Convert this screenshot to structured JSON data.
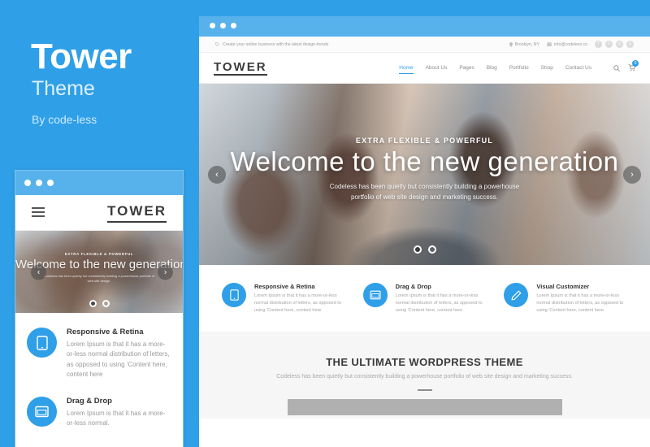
{
  "promo": {
    "title": "Tower",
    "subtitle": "Theme",
    "author": "By code-less"
  },
  "colors": {
    "brand_blue": "#2fa0e8",
    "chrome_blue": "#57b2ec",
    "icon_blue": "#2f9fe8",
    "cta_bg": "#f6f6f6"
  },
  "desktop_window": {
    "topbar": {
      "tagline": "Create your online business with the latest design-trends",
      "location": "Brooklyn, NY",
      "email": "info@codeless.co",
      "social": [
        "facebook-icon",
        "twitter-icon",
        "google-plus-icon",
        "pinterest-icon"
      ]
    },
    "nav": {
      "logo": "TOWER",
      "items": [
        {
          "label": "Home",
          "active": true
        },
        {
          "label": "About Us",
          "active": false
        },
        {
          "label": "Pages",
          "active": false
        },
        {
          "label": "Blog",
          "active": false
        },
        {
          "label": "Portfolio",
          "active": false
        },
        {
          "label": "Shop",
          "active": false
        },
        {
          "label": "Contact Us",
          "active": false
        }
      ],
      "search_icon": "search-icon",
      "cart_icon": "cart-icon",
      "cart_count": "0"
    },
    "hero": {
      "kicker": "EXTRA FLEXIBLE & POWERFUL",
      "title": "Welcome to the new generation",
      "description": "Codeless has been quietly but consistently building a powerhouse portfolio of web site design and marketing success.",
      "prev_label": "‹",
      "next_label": "›",
      "slides": 2,
      "active_slide": 1
    },
    "features": [
      {
        "icon": "tablet-icon",
        "title": "Responsive & Retina",
        "text": "Lorem Ipsum is that it has a more-or-less normal distribution of letters, as opposed to using 'Content here, content here"
      },
      {
        "icon": "drag-drop-icon",
        "title": "Drag & Drop",
        "text": "Lorem Ipsum is that it has a more-or-less normal distribution of letters, as opposed to using 'Content here, content here"
      },
      {
        "icon": "pencil-icon",
        "title": "Visual Customizer",
        "text": "Lorem Ipsum is that it has a more-or-less normal distribution of letters, as opposed to using 'Content here, content here"
      }
    ],
    "cta": {
      "heading": "THE ULTIMATE WORDPRESS THEME",
      "subtext": "Codeless has been quietly but consistently building a powerhouse portfolio of web site design and marketing success."
    }
  },
  "tablet_window": {
    "menu_icon": "hamburger-icon",
    "logo": "TOWER",
    "hero": {
      "kicker": "EXTRA FLEXIBLE & POWERFUL",
      "title": "Welcome to the new generation",
      "description": "Codeless has been quietly but consistently building a powerhouse portfolio of web site design.",
      "prev_label": "‹",
      "next_label": "›",
      "slides": 2,
      "active_slide": 1
    },
    "features": [
      {
        "icon": "tablet-icon",
        "title": "Responsive & Retina",
        "text": "Lorem Ipsum is that it has a more-or-less normal distribution of letters, as opposed to using 'Content here, content here"
      },
      {
        "icon": "drag-drop-icon",
        "title": "Drag & Drop",
        "text": "Lorem Ipsum is that it has a more-or-less normal."
      }
    ]
  }
}
